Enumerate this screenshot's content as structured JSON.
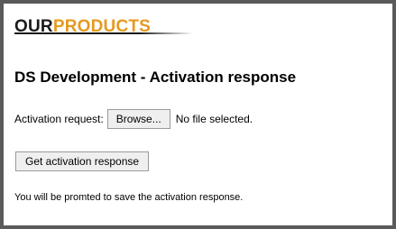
{
  "logo": {
    "part1": "OUR",
    "part2": "PRODUCTS"
  },
  "page": {
    "title": "DS Development - Activation response"
  },
  "form": {
    "activation_label": "Activation request:",
    "browse_label": "Browse...",
    "file_status": "No file selected.",
    "submit_label": "Get activation response",
    "note": "You will be promted to save the activation response."
  },
  "colors": {
    "logo_dark": "#1a1a1a",
    "logo_accent": "#e59a1f",
    "frame_border": "#5a5a5a"
  }
}
